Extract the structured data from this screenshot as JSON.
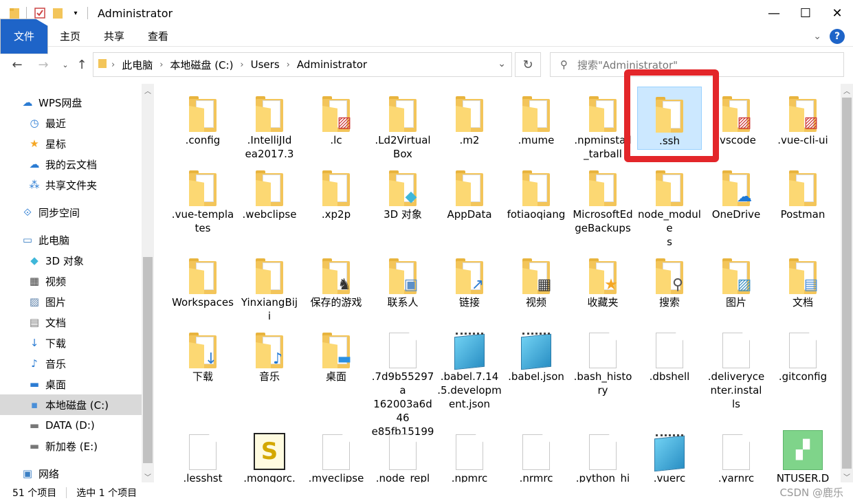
{
  "window": {
    "title": "Administrator",
    "minimize": "—",
    "maximize": "☐",
    "close": "✕"
  },
  "ribbon": {
    "file": "文件",
    "tabs": [
      "主页",
      "共享",
      "查看"
    ],
    "help": "?"
  },
  "address": {
    "crumbs": [
      "此电脑",
      "本地磁盘 (C:)",
      "Users",
      "Administrator"
    ]
  },
  "search": {
    "placeholder": "搜索\"Administrator\""
  },
  "sidebar": {
    "items": [
      {
        "label": "WPS网盘",
        "icon": "cloud-icon"
      },
      {
        "label": "最近",
        "icon": "clock-icon"
      },
      {
        "label": "星标",
        "icon": "star-icon"
      },
      {
        "label": "我的云文档",
        "icon": "cloud-doc-icon"
      },
      {
        "label": "共享文件夹",
        "icon": "share-icon"
      },
      {
        "label": "同步空间",
        "icon": "sync-icon"
      },
      {
        "label": "此电脑",
        "icon": "computer-icon"
      },
      {
        "label": "3D 对象",
        "icon": "cube-icon"
      },
      {
        "label": "视频",
        "icon": "video-icon"
      },
      {
        "label": "图片",
        "icon": "picture-icon"
      },
      {
        "label": "文档",
        "icon": "document-icon"
      },
      {
        "label": "下载",
        "icon": "download-icon"
      },
      {
        "label": "音乐",
        "icon": "music-icon"
      },
      {
        "label": "桌面",
        "icon": "desktop-icon"
      },
      {
        "label": "本地磁盘 (C:)",
        "icon": "drive-c-icon"
      },
      {
        "label": "DATA (D:)",
        "icon": "drive-icon"
      },
      {
        "label": "新加卷 (E:)",
        "icon": "drive-icon"
      },
      {
        "label": "网络",
        "icon": "network-icon"
      }
    ]
  },
  "files": [
    {
      "name": ".config",
      "type": "folder"
    },
    {
      "name": ".IntelliJIdea2017.3",
      "type": "folder"
    },
    {
      "name": ".lc",
      "type": "folder"
    },
    {
      "name": ".Ld2VirtualBox",
      "type": "folder"
    },
    {
      "name": ".m2",
      "type": "folder"
    },
    {
      "name": ".mume",
      "type": "folder"
    },
    {
      "name": ".npminstall_tarball",
      "type": "folder"
    },
    {
      "name": ".ssh",
      "type": "folder"
    },
    {
      "name": ".vscode",
      "type": "folder"
    },
    {
      "name": ".vue-cli-ui",
      "type": "folder"
    },
    {
      "name": ".vue-templates",
      "type": "folder"
    },
    {
      "name": ".webclipse",
      "type": "folder"
    },
    {
      "name": ".xp2p",
      "type": "folder"
    },
    {
      "name": "3D 对象",
      "type": "folder"
    },
    {
      "name": "AppData",
      "type": "folder"
    },
    {
      "name": "fotiaoqiang",
      "type": "folder"
    },
    {
      "name": "MicrosoftEdgeBackups",
      "type": "folder"
    },
    {
      "name": "node_modules",
      "type": "folder"
    },
    {
      "name": "OneDrive",
      "type": "folder"
    },
    {
      "name": "Postman",
      "type": "folder"
    },
    {
      "name": "Workspaces",
      "type": "folder"
    },
    {
      "name": "YinxiangBiji",
      "type": "folder"
    },
    {
      "name": "保存的游戏",
      "type": "folder"
    },
    {
      "name": "联系人",
      "type": "folder"
    },
    {
      "name": "链接",
      "type": "folder"
    },
    {
      "name": "视频",
      "type": "folder"
    },
    {
      "name": "收藏夹",
      "type": "folder"
    },
    {
      "name": "搜索",
      "type": "folder"
    },
    {
      "name": "图片",
      "type": "folder"
    },
    {
      "name": "文档",
      "type": "folder"
    },
    {
      "name": "下载",
      "type": "folder"
    },
    {
      "name": "音乐",
      "type": "folder"
    },
    {
      "name": "桌面",
      "type": "folder"
    },
    {
      "name": ".7d9b55297a162003a6d46e85fb151995…",
      "type": "file"
    },
    {
      "name": ".babel.7.14.5.development.json",
      "type": "notepad"
    },
    {
      "name": ".babel.json",
      "type": "notepad"
    },
    {
      "name": ".bash_history",
      "type": "file"
    },
    {
      "name": ".dbshell",
      "type": "file"
    },
    {
      "name": ".deliverycenter.installs",
      "type": "file"
    },
    {
      "name": ".gitconfig",
      "type": "file"
    },
    {
      "name": ".lesshst",
      "type": "file"
    },
    {
      "name": ".mongorc.",
      "type": "script"
    },
    {
      "name": ".myeclipse",
      "type": "file"
    },
    {
      "name": ".node_repl",
      "type": "file"
    },
    {
      "name": ".npmrc",
      "type": "file"
    },
    {
      "name": ".nrmrc",
      "type": "file"
    },
    {
      "name": ".python_hi",
      "type": "file"
    },
    {
      "name": ".vuerc",
      "type": "notepad"
    },
    {
      "name": ".yarnrc",
      "type": "file"
    },
    {
      "name": "NTUSER.D",
      "type": "green"
    }
  ],
  "selected_file": ".ssh",
  "status": {
    "count": "51 个项目",
    "selected": "选中 1 个项目"
  },
  "watermark": "CSDN @鹿乐",
  "colors": {
    "accent": "#1e64c8",
    "highlight": "#e3262a",
    "selection": "#cce8ff"
  }
}
